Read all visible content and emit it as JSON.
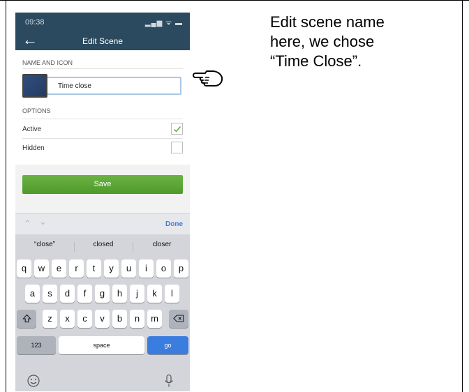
{
  "status_bar": {
    "time": "09:38",
    "icons": "▂▄▆ ᯤ ▬"
  },
  "header": {
    "title": "Edit Scene"
  },
  "name_section": {
    "label": "NAME AND ICON",
    "name_value": "Time close"
  },
  "options_section": {
    "label": "OPTIONS",
    "items": [
      {
        "label": "Active",
        "checked": true
      },
      {
        "label": "Hidden",
        "checked": false
      }
    ]
  },
  "save_label": "Save",
  "keyboard_toolbar": {
    "done_label": "Done"
  },
  "keyboard": {
    "suggestions": [
      "“close”",
      "closed",
      "closer"
    ],
    "row1": [
      "q",
      "w",
      "e",
      "r",
      "t",
      "y",
      "u",
      "i",
      "o",
      "p"
    ],
    "row2": [
      "a",
      "s",
      "d",
      "f",
      "g",
      "h",
      "j",
      "k",
      "l"
    ],
    "row3": [
      "z",
      "x",
      "c",
      "v",
      "b",
      "n",
      "m"
    ],
    "numbers_label": "123",
    "space_label": "space",
    "go_label": "go"
  },
  "caption": {
    "lines": [
      "Edit scene name",
      "here, we chose",
      "“Time Close”."
    ]
  },
  "colors": {
    "header_bg": "#2b4a5f",
    "save_green": "#5aa536",
    "go_blue": "#3a7ddf"
  },
  "icons": [
    "back-arrow-icon",
    "checkmark-icon",
    "shift-icon",
    "backspace-icon",
    "emoji-icon",
    "microphone-icon",
    "pointing-hand-icon"
  ]
}
